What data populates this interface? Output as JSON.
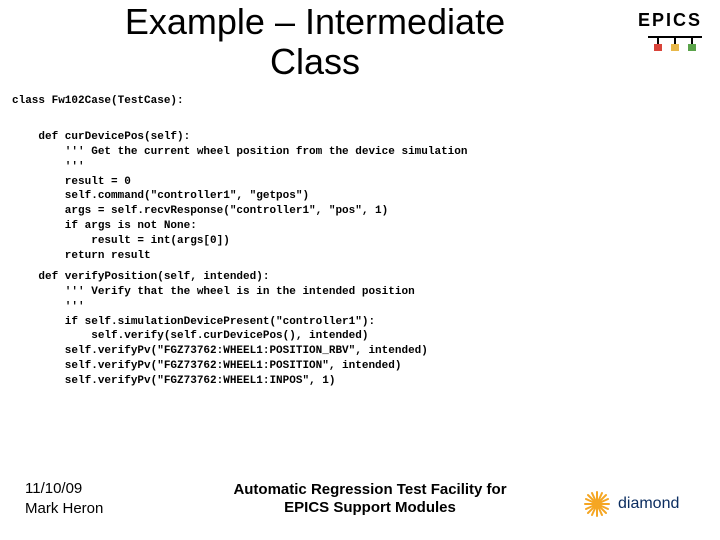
{
  "title": "Example – Intermediate Class",
  "epics_label": "EPICS",
  "class_declaration": "class Fw102Case(TestCase):",
  "code_block_1": "    def curDevicePos(self):\n        ''' Get the current wheel position from the device simulation\n        '''\n        result = 0\n        self.command(\"controller1\", \"getpos\")\n        args = self.recvResponse(\"controller1\", \"pos\", 1)\n        if args is not None:\n            result = int(args[0])\n        return result",
  "code_block_2": "    def verifyPosition(self, intended):\n        ''' Verify that the wheel is in the intended position\n        '''\n        if self.simulationDevicePresent(\"controller1\"):\n            self.verify(self.curDevicePos(), intended)\n        self.verifyPv(\"FGZ73762:WHEEL1:POSITION_RBV\", intended)\n        self.verifyPv(\"FGZ73762:WHEEL1:POSITION\", intended)\n        self.verifyPv(\"FGZ73762:WHEEL1:INPOS\", 1)",
  "footer": {
    "date": "11/10/09",
    "author": "Mark Heron",
    "subtitle": "Automatic Regression Test Facility for EPICS Support Modules"
  },
  "logo_text": "diamond"
}
